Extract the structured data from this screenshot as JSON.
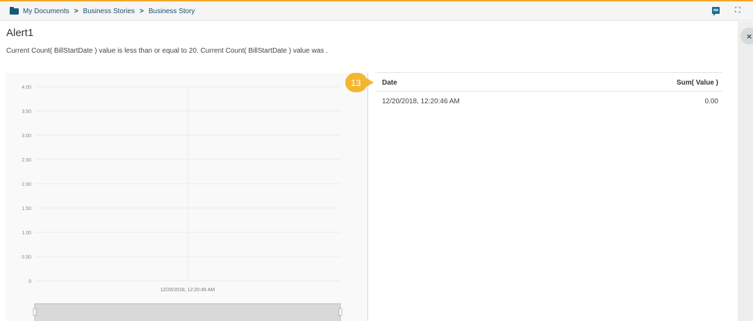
{
  "breadcrumb": {
    "items": [
      "My Documents",
      "Business Stories",
      "Business Story"
    ],
    "separator": ">"
  },
  "toolbar": {
    "comment_icon": "comment-icon",
    "fullscreen_icon": "fullscreen-icon",
    "fullscreen_glyph": "⛶"
  },
  "side_panel": {
    "close_glyph": "×"
  },
  "alert": {
    "title": "Alert1",
    "message": "Current Count( BillStartDate ) value is less than or equal to 20. Current Count( BillStartDate ) value was ."
  },
  "callout": {
    "label": "13",
    "color": "#f2b632"
  },
  "table": {
    "columns": [
      "Date",
      "Sum( Value )"
    ],
    "rows": [
      [
        "12/20/2018, 12:20:46 AM",
        "0.00"
      ]
    ]
  },
  "chart_data": {
    "type": "bar",
    "categories": [
      "12/20/2018, 12:20:46 AM"
    ],
    "values": [
      0
    ],
    "ylim": [
      0,
      4
    ],
    "yticks": [
      "0",
      "0.50",
      "1.00",
      "1.50",
      "2.00",
      "2.50",
      "3.00",
      "3.50",
      "4.00"
    ],
    "grid": true
  },
  "colors": {
    "accent": "#f5a623",
    "brand": "#1c4f6e"
  }
}
